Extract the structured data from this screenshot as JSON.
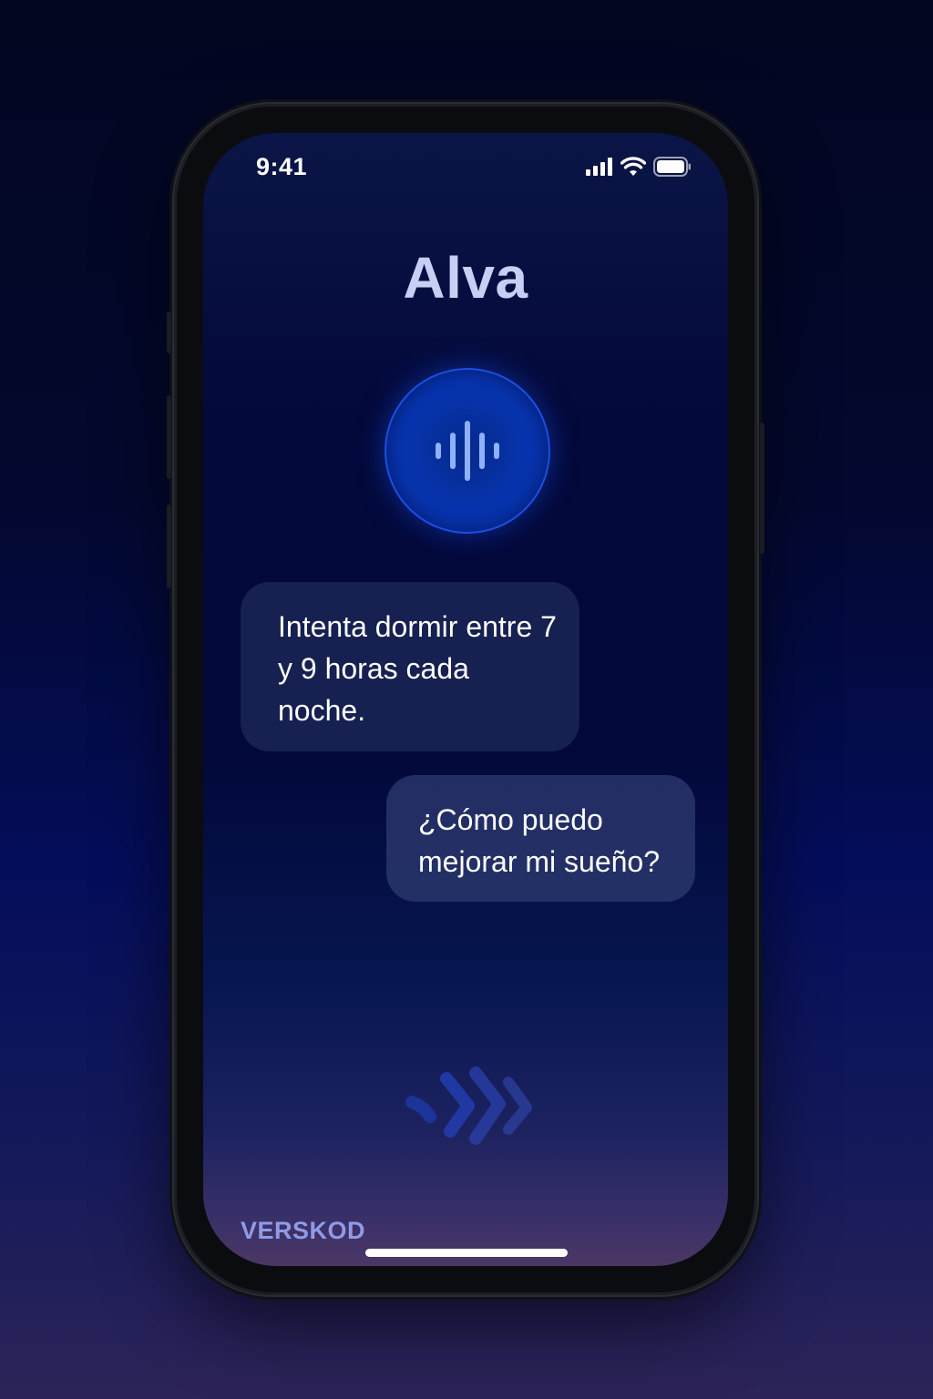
{
  "status_bar": {
    "time": "9:41",
    "icons": [
      "cellular-signal-icon",
      "wifi-icon",
      "battery-icon"
    ]
  },
  "app": {
    "title": "Alva"
  },
  "voice_button": {
    "icon": "sound-wave-icon",
    "accent_color": "#0a3fc8"
  },
  "messages": [
    {
      "role": "assistant",
      "text": "Intenta dormir entre 7 y 9 horas cada noche."
    },
    {
      "role": "user",
      "text": "¿Cómo puedo mejorar mi sueño?"
    }
  ],
  "decoration": {
    "icon": "listening-chevrons-icon"
  },
  "brand": {
    "label": "VERSKOD"
  }
}
